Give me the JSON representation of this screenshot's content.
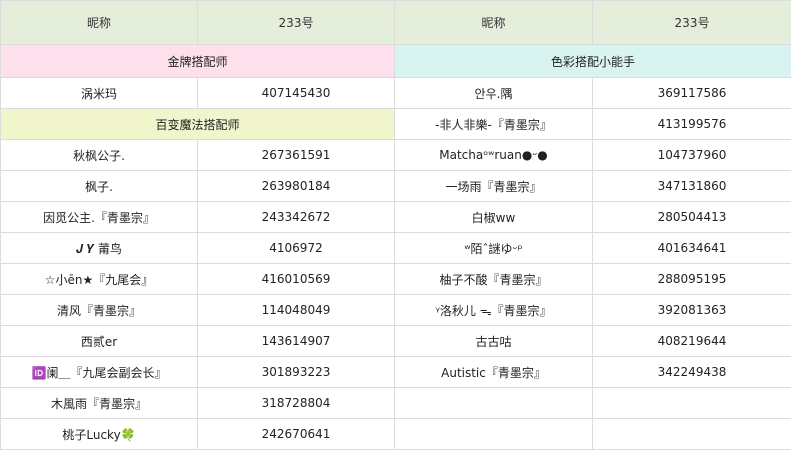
{
  "header": [
    "昵称",
    "233号",
    "昵称",
    "233号"
  ],
  "colors": {
    "header_bg": "#e4eedb",
    "gold_section_bg": "#fde0ec",
    "color_section_bg": "#d8f3f0",
    "magic_section_bg": "#f1f5cc"
  },
  "sections": {
    "gold": "金牌搭配师",
    "color": "色彩搭配小能手",
    "magic": "百变魔法搭配师"
  },
  "left": {
    "gold_members": [
      {
        "nick": "涡米玛",
        "id": "407145430"
      }
    ],
    "magic_members": [
      {
        "nick": "秋枫公子.",
        "id": "267361591"
      },
      {
        "nick": "枫子.",
        "id": "263980184"
      },
      {
        "nick": "因觅公主.『青墨宗』",
        "id": "243342672"
      },
      {
        "nick": "𝑱 𝒀 莆鸟",
        "id": "4106972"
      },
      {
        "nick": "☆小ēn★『九尾会』",
        "id": "416010569"
      },
      {
        "nick": "清风『青墨宗』",
        "id": "114048049"
      },
      {
        "nick": "西贰er",
        "id": "143614907"
      },
      {
        "nick": "🆔阑＿『九尾会副会长』",
        "id": "301893223"
      },
      {
        "nick": "木風雨『青墨宗』",
        "id": "318728804"
      },
      {
        "nick": "桃子Lucky🍀",
        "id": "242670641"
      }
    ]
  },
  "right": {
    "members": [
      {
        "nick": "안우.隅",
        "id": "369117586"
      },
      {
        "nick": "-非人非樂-『青墨宗』",
        "id": "413199576"
      },
      {
        "nick": "Matchaᵒʷruan●ᵕ●",
        "id": "104737960"
      },
      {
        "nick": "一场雨『青墨宗』",
        "id": "347131860"
      },
      {
        "nick": "白椒ww",
        "id": "280504413"
      },
      {
        "nick": "ʷ陌ˆ謎ゆᵕᵖ",
        "id": "401634641"
      },
      {
        "nick": "柚子不酸『青墨宗』",
        "id": "288095195"
      },
      {
        "nick": "ᵞ洛秋儿 ᯓ『青墨宗』",
        "id": "392081363"
      },
      {
        "nick": "古古咕",
        "id": "408219644"
      },
      {
        "nick": "Autistic『青墨宗』",
        "id": "342249438"
      }
    ]
  }
}
